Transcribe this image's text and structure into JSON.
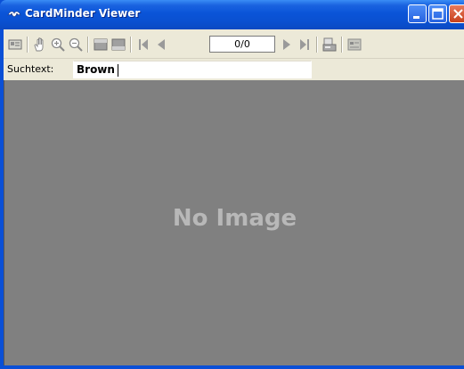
{
  "window": {
    "title": "CardMinder Viewer",
    "app_icon": "cardminder-app-icon"
  },
  "title_buttons": {
    "minimize": "minimize-icon",
    "maximize": "maximize-icon",
    "close": "close-icon"
  },
  "toolbar": {
    "icons": [
      "card-view-icon",
      "hand-pan-icon",
      "zoom-in-icon",
      "zoom-out-icon",
      "front-side-icon",
      "back-side-icon",
      "first-record-icon",
      "previous-record-icon",
      "next-record-icon",
      "last-record-icon",
      "scan-icon",
      "export-icon"
    ],
    "page_indicator": "0/0"
  },
  "search": {
    "label": "Suchtext:",
    "value": "Brown"
  },
  "viewer": {
    "placeholder": "No Image"
  },
  "colors": {
    "titlebar": "#0a54d8",
    "toolbar_bg": "#ece9d8",
    "image_bg": "#808080",
    "placeholder_text": "#b8b8b8"
  }
}
